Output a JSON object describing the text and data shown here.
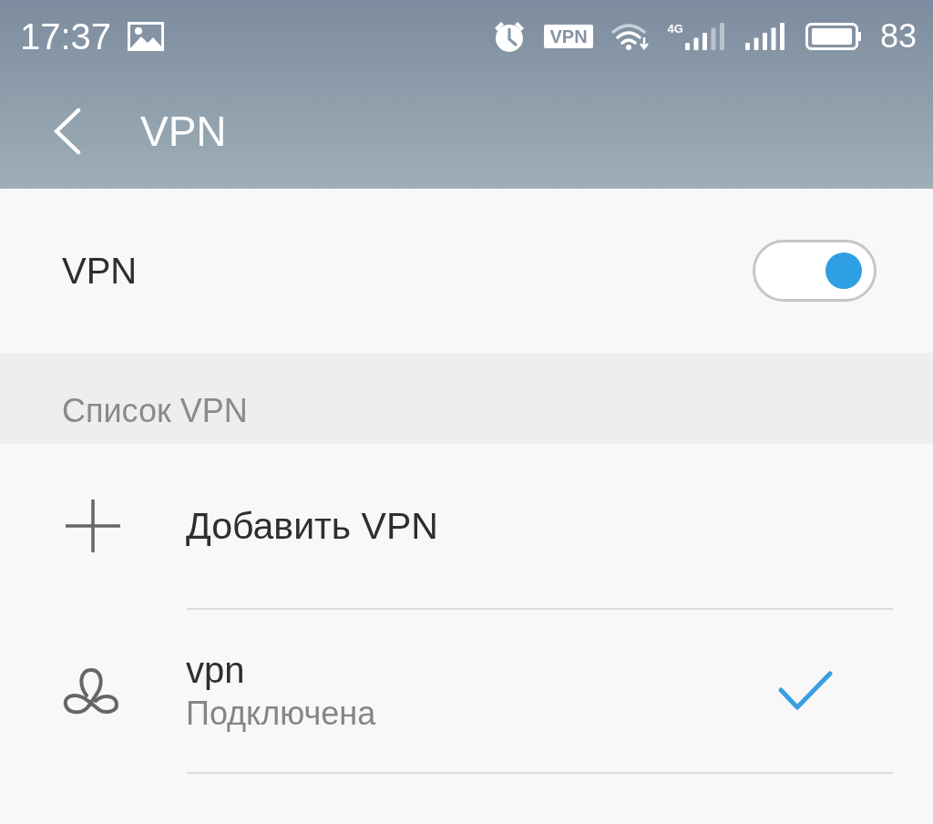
{
  "status_bar": {
    "time": "17:37",
    "vpn_badge": "VPN",
    "network_type": "4G",
    "battery": "83"
  },
  "app_bar": {
    "title": "VPN"
  },
  "vpn_toggle": {
    "label": "VPN",
    "on": true
  },
  "section": {
    "title": "Список VPN"
  },
  "add_item": {
    "label": "Добавить VPN"
  },
  "profiles": [
    {
      "name": "vpn",
      "status": "Подключена",
      "selected": true
    }
  ]
}
